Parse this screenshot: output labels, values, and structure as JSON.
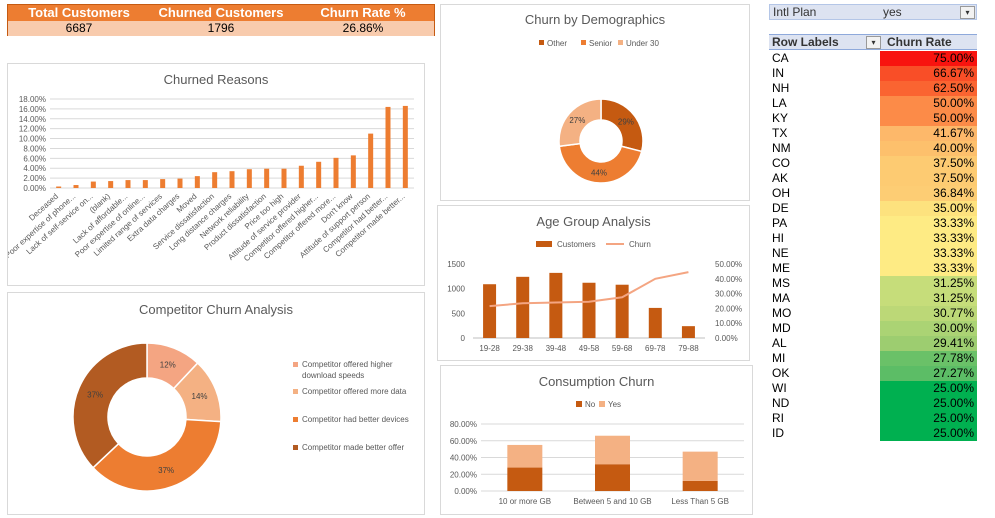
{
  "kpi": {
    "headers": [
      "Total Customers",
      "Churned Customers",
      "Churn Rate %"
    ],
    "values": [
      "6687",
      "1796",
      "26.86%"
    ]
  },
  "filter": {
    "label": "Intl Plan",
    "value": "yes"
  },
  "pivot": {
    "col_labels": "Row Labels",
    "col_rate": "Churn Rate",
    "rows": [
      {
        "state": "CA",
        "rate": "75.00%",
        "color": "#f8130f"
      },
      {
        "state": "IN",
        "rate": "66.67%",
        "color": "#f94e27"
      },
      {
        "state": "NH",
        "rate": "62.50%",
        "color": "#fa6431"
      },
      {
        "state": "LA",
        "rate": "50.00%",
        "color": "#fc8b48"
      },
      {
        "state": "KY",
        "rate": "50.00%",
        "color": "#fc8b48"
      },
      {
        "state": "TX",
        "rate": "41.67%",
        "color": "#fdb86a"
      },
      {
        "state": "NM",
        "rate": "40.00%",
        "color": "#fdc06c"
      },
      {
        "state": "CO",
        "rate": "37.50%",
        "color": "#fdcb72"
      },
      {
        "state": "AK",
        "rate": "37.50%",
        "color": "#fdcb72"
      },
      {
        "state": "OH",
        "rate": "36.84%",
        "color": "#fdcd74"
      },
      {
        "state": "DE",
        "rate": "35.00%",
        "color": "#fde27e"
      },
      {
        "state": "PA",
        "rate": "33.33%",
        "color": "#feeb84"
      },
      {
        "state": "HI",
        "rate": "33.33%",
        "color": "#feeb84"
      },
      {
        "state": "NE",
        "rate": "33.33%",
        "color": "#feeb84"
      },
      {
        "state": "ME",
        "rate": "33.33%",
        "color": "#feeb84"
      },
      {
        "state": "MS",
        "rate": "31.25%",
        "color": "#c6dd7a"
      },
      {
        "state": "MA",
        "rate": "31.25%",
        "color": "#c6dd7a"
      },
      {
        "state": "MO",
        "rate": "30.77%",
        "color": "#bcd877"
      },
      {
        "state": "MD",
        "rate": "30.00%",
        "color": "#abd374"
      },
      {
        "state": "AL",
        "rate": "29.41%",
        "color": "#9dcd70"
      },
      {
        "state": "MI",
        "rate": "27.78%",
        "color": "#6ac168"
      },
      {
        "state": "OK",
        "rate": "27.27%",
        "color": "#5cbd66"
      },
      {
        "state": "WI",
        "rate": "25.00%",
        "color": "#00b050"
      },
      {
        "state": "ND",
        "rate": "25.00%",
        "color": "#00b050"
      },
      {
        "state": "RI",
        "rate": "25.00%",
        "color": "#00b050"
      },
      {
        "state": "ID",
        "rate": "25.00%",
        "color": "#00b050"
      }
    ]
  },
  "colors": {
    "orange": "#ed7d31",
    "dark_orange": "#c55a11",
    "brown": "#b25b22",
    "light": "#f4b183",
    "peach": "#f4a582"
  },
  "chart_data": [
    {
      "id": "churned-reasons",
      "type": "bar",
      "title": "Churned Reasons",
      "categories": [
        "Deceased",
        "Poor expertise of phone...",
        "Lack of self-service on...",
        "(blank)",
        "Lack of affordable...",
        "Poor expertise of online...",
        "Limited range of services",
        "Extra data charges",
        "Moved",
        "Service dissatisfaction",
        "Long distance charges",
        "Network reliability",
        "Product dissatisfaction",
        "Price too high",
        "Attitude of service provider",
        "Competitor offered higher...",
        "Competitor offered more...",
        "Don't know",
        "Attitude of support person",
        "Competitor had better...",
        "Competitor made better..."
      ],
      "values": [
        0.3,
        0.6,
        1.3,
        1.4,
        1.6,
        1.6,
        1.8,
        1.9,
        2.4,
        3.2,
        3.4,
        3.8,
        3.9,
        3.9,
        4.5,
        5.3,
        6.1,
        6.6,
        11.0,
        16.4,
        16.6
      ],
      "ylim": [
        0,
        18
      ],
      "yticks": [
        "0.00%",
        "2.00%",
        "4.00%",
        "6.00%",
        "8.00%",
        "10.00%",
        "12.00%",
        "14.00%",
        "16.00%",
        "18.00%"
      ],
      "grid": true
    },
    {
      "id": "demographics",
      "type": "pie",
      "donut": true,
      "title": "Churn by Demographics",
      "labels": [
        "Other",
        "Senior",
        "Under 30"
      ],
      "values": [
        29,
        44,
        27
      ],
      "data_labels": [
        "29%",
        "44%",
        "27%"
      ],
      "legend": "top"
    },
    {
      "id": "age-group",
      "type": "bar",
      "title": "Age Group Analysis",
      "categories": [
        "19-28",
        "29-38",
        "39-48",
        "49-58",
        "59-68",
        "69-78",
        "79-88"
      ],
      "series": [
        {
          "name": "Customers",
          "values": [
            1090,
            1240,
            1320,
            1120,
            1080,
            610,
            240
          ]
        },
        {
          "name": "Churn",
          "values": [
            21.5,
            23.5,
            24.0,
            24.5,
            27.5,
            40.0,
            44.5
          ]
        }
      ],
      "ylim": [
        0,
        1500
      ],
      "yticks": [
        "0",
        "500",
        "1000",
        "1500"
      ],
      "y2lim": [
        0,
        50
      ],
      "y2ticks": [
        "0.00%",
        "10.00%",
        "20.00%",
        "30.00%",
        "40.00%",
        "50.00%"
      ],
      "legend": "top"
    },
    {
      "id": "competitor",
      "type": "pie",
      "donut": true,
      "title": "Competitor Churn Analysis",
      "labels": [
        "Competitor offered higher download speeds",
        "Competitor offered more data",
        "Competitor had better devices",
        "Competitor made better offer"
      ],
      "values": [
        12,
        14,
        37,
        37
      ],
      "data_labels": [
        "12%",
        "14%",
        "37%",
        "37%"
      ],
      "legend": "right"
    },
    {
      "id": "consumption",
      "type": "bar",
      "stacked": true,
      "title": "Consumption Churn",
      "categories": [
        "10 or more GB",
        "Between 5 and 10 GB",
        "Less Than 5 GB"
      ],
      "series": [
        {
          "name": "No",
          "values": [
            28,
            32,
            12
          ]
        },
        {
          "name": "Yes",
          "values": [
            27,
            34,
            35
          ]
        }
      ],
      "ylim": [
        0,
        80
      ],
      "yticks": [
        "0.00%",
        "20.00%",
        "40.00%",
        "60.00%",
        "80.00%"
      ],
      "legend": "top"
    }
  ]
}
